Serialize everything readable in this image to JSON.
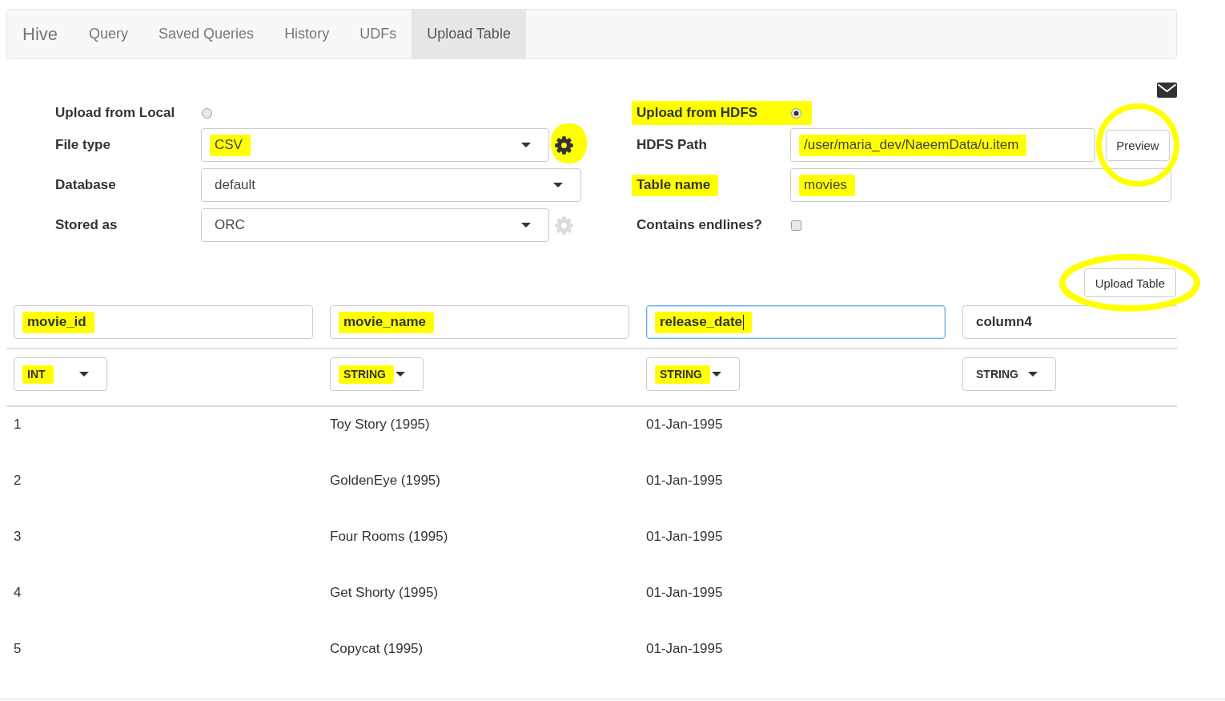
{
  "navbar": {
    "brand": "Hive",
    "tabs": [
      {
        "label": "Query",
        "selected": false
      },
      {
        "label": "Saved Queries",
        "selected": false
      },
      {
        "label": "History",
        "selected": false
      },
      {
        "label": "UDFs",
        "selected": false
      },
      {
        "label": "Upload Table",
        "selected": true
      }
    ]
  },
  "local_upload": {
    "option": {
      "label": "Upload from Local",
      "selected": false,
      "highlighted": false
    },
    "fields": [
      {
        "kind": "select",
        "label": "File type",
        "label_highlighted": false,
        "value": "CSV",
        "value_highlighted": true,
        "settings": {
          "disabled": false,
          "highlighted": true
        }
      },
      {
        "kind": "select",
        "label": "Database",
        "label_highlighted": false,
        "value": "default",
        "value_highlighted": false
      },
      {
        "kind": "select",
        "label": "Stored as",
        "label_highlighted": false,
        "value": "ORC",
        "value_highlighted": false,
        "settings": {
          "disabled": true,
          "highlighted": false
        }
      }
    ]
  },
  "hdfs_upload": {
    "option": {
      "label": "Upload from HDFS",
      "selected": true,
      "highlighted": true
    },
    "fields": [
      {
        "kind": "text",
        "label": "HDFS Path",
        "label_highlighted": false,
        "value": "/user/maria_dev/NaeemData/u.item",
        "value_highlighted": true,
        "button": {
          "label": "Preview",
          "circled": true
        }
      },
      {
        "kind": "text",
        "label": "Table name",
        "label_highlighted": true,
        "value": "movies",
        "value_highlighted": true
      },
      {
        "kind": "checkbox",
        "label": "Contains endlines?",
        "label_highlighted": false,
        "checked": false
      }
    ]
  },
  "upload_button": {
    "label": "Upload Table",
    "circled": true
  },
  "table": {
    "columns": [
      {
        "name": "movie_id",
        "name_highlighted": true,
        "focused": false,
        "type": "INT",
        "type_highlighted": true
      },
      {
        "name": "movie_name",
        "name_highlighted": true,
        "focused": false,
        "type": "STRING",
        "type_highlighted": true
      },
      {
        "name": "release_date",
        "name_highlighted": true,
        "focused": true,
        "type": "STRING",
        "type_highlighted": true
      },
      {
        "name": "column4",
        "name_highlighted": false,
        "focused": false,
        "type": "STRING",
        "type_highlighted": false
      }
    ],
    "rows": [
      [
        "1",
        "Toy Story (1995)",
        "01-Jan-1995"
      ],
      [
        "2",
        "GoldenEye (1995)",
        "01-Jan-1995"
      ],
      [
        "3",
        "Four Rooms (1995)",
        "01-Jan-1995"
      ],
      [
        "4",
        "Get Shorty (1995)",
        "01-Jan-1995"
      ],
      [
        "5",
        "Copycat (1995)",
        "01-Jan-1995"
      ]
    ]
  }
}
